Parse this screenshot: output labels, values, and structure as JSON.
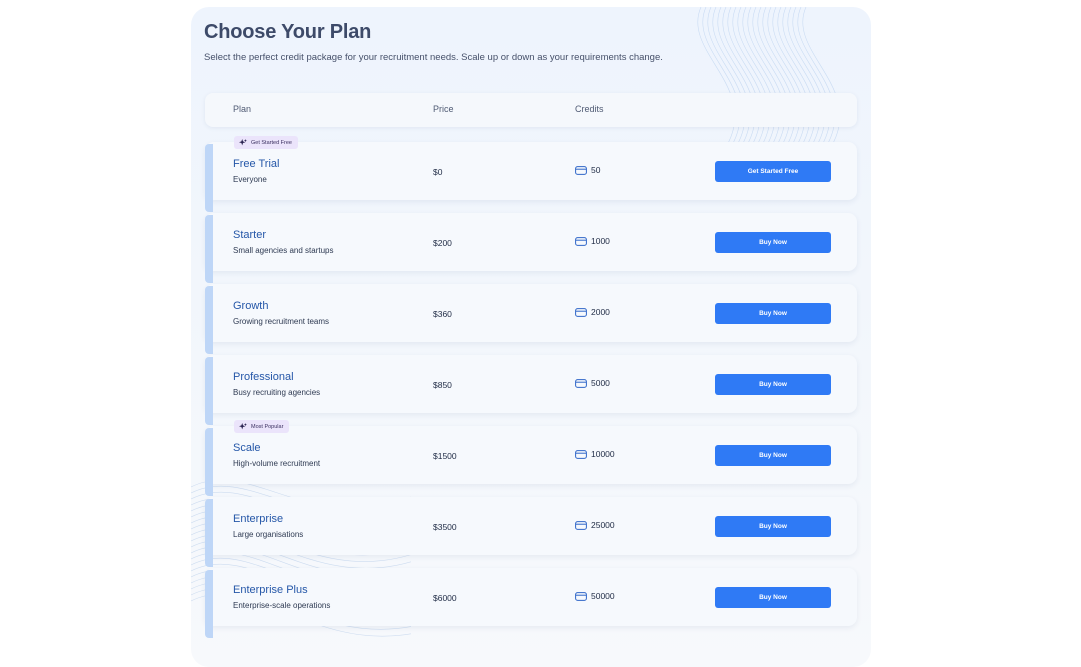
{
  "title": "Choose Your Plan",
  "subtitle": "Select the perfect credit package for your recruitment needs. Scale up or down as your requirements change.",
  "table_headers": {
    "plan": "Plan",
    "price": "Price",
    "credits": "Credits"
  },
  "icons": {
    "badge": "sparkle-icon",
    "credits": "credit-card-icon"
  },
  "colors": {
    "accent": "#2f7af5",
    "plan_name": "#2557a8",
    "badge_bg": "#ebe4fb",
    "row_bar": "#bed6f7"
  },
  "plans": [
    {
      "name": "Free Trial",
      "description": "Everyone",
      "price": "$0",
      "credits": "50",
      "button": "Get Started Free",
      "badge": "Get Started Free"
    },
    {
      "name": "Starter",
      "description": "Small agencies and startups",
      "price": "$200",
      "credits": "1000",
      "button": "Buy Now"
    },
    {
      "name": "Growth",
      "description": "Growing recruitment teams",
      "price": "$360",
      "credits": "2000",
      "button": "Buy Now"
    },
    {
      "name": "Professional",
      "description": "Busy recruiting agencies",
      "price": "$850",
      "credits": "5000",
      "button": "Buy Now"
    },
    {
      "name": "Scale",
      "description": "High-volume recruitment",
      "price": "$1500",
      "credits": "10000",
      "button": "Buy Now",
      "badge": "Most Popular"
    },
    {
      "name": "Enterprise",
      "description": "Large organisations",
      "price": "$3500",
      "credits": "25000",
      "button": "Buy Now"
    },
    {
      "name": "Enterprise Plus",
      "description": "Enterprise-scale operations",
      "price": "$6000",
      "credits": "50000",
      "button": "Buy Now"
    }
  ]
}
